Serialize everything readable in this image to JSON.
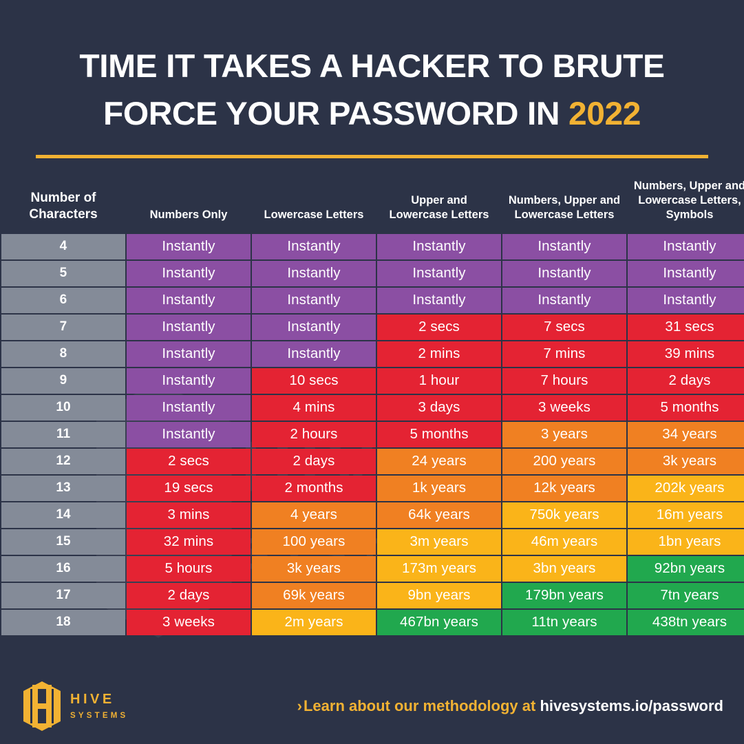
{
  "colors": {
    "background": "#2c3347",
    "accent": "#f2b233",
    "gray": "#848b98",
    "purple": "#8b4fa3",
    "red": "#e42333",
    "orange": "#f08022",
    "yellow": "#fab419",
    "green": "#21a84e",
    "text": "#ffffff"
  },
  "header": {
    "title_line1": "TIME IT TAKES A HACKER TO BRUTE",
    "title_line2_prefix": "FORCE YOUR PASSWORD IN ",
    "title_year": "2022"
  },
  "table": {
    "columns": [
      "Number of Characters",
      "Numbers Only",
      "Lowercase Letters",
      "Upper and Lowercase Letters",
      "Numbers, Upper and Lowercase Letters",
      "Numbers, Upper and Lowercase Letters, Symbols"
    ],
    "rows": [
      {
        "chars": "4",
        "cells": [
          "Instantly",
          "Instantly",
          "Instantly",
          "Instantly",
          "Instantly"
        ],
        "colors": [
          "purple",
          "purple",
          "purple",
          "purple",
          "purple"
        ]
      },
      {
        "chars": "5",
        "cells": [
          "Instantly",
          "Instantly",
          "Instantly",
          "Instantly",
          "Instantly"
        ],
        "colors": [
          "purple",
          "purple",
          "purple",
          "purple",
          "purple"
        ]
      },
      {
        "chars": "6",
        "cells": [
          "Instantly",
          "Instantly",
          "Instantly",
          "Instantly",
          "Instantly"
        ],
        "colors": [
          "purple",
          "purple",
          "purple",
          "purple",
          "purple"
        ]
      },
      {
        "chars": "7",
        "cells": [
          "Instantly",
          "Instantly",
          "2 secs",
          "7 secs",
          "31 secs"
        ],
        "colors": [
          "purple",
          "purple",
          "red",
          "red",
          "red"
        ]
      },
      {
        "chars": "8",
        "cells": [
          "Instantly",
          "Instantly",
          "2 mins",
          "7 mins",
          "39 mins"
        ],
        "colors": [
          "purple",
          "purple",
          "red",
          "red",
          "red"
        ]
      },
      {
        "chars": "9",
        "cells": [
          "Instantly",
          "10 secs",
          "1 hour",
          "7 hours",
          "2 days"
        ],
        "colors": [
          "purple",
          "red",
          "red",
          "red",
          "red"
        ]
      },
      {
        "chars": "10",
        "cells": [
          "Instantly",
          "4 mins",
          "3 days",
          "3 weeks",
          "5 months"
        ],
        "colors": [
          "purple",
          "red",
          "red",
          "red",
          "red"
        ]
      },
      {
        "chars": "11",
        "cells": [
          "Instantly",
          "2 hours",
          "5 months",
          "3 years",
          "34 years"
        ],
        "colors": [
          "purple",
          "red",
          "red",
          "orange",
          "orange"
        ]
      },
      {
        "chars": "12",
        "cells": [
          "2 secs",
          "2 days",
          "24 years",
          "200 years",
          "3k years"
        ],
        "colors": [
          "red",
          "red",
          "orange",
          "orange",
          "orange"
        ]
      },
      {
        "chars": "13",
        "cells": [
          "19 secs",
          "2 months",
          "1k years",
          "12k years",
          "202k years"
        ],
        "colors": [
          "red",
          "red",
          "orange",
          "orange",
          "yellow"
        ]
      },
      {
        "chars": "14",
        "cells": [
          "3 mins",
          "4 years",
          "64k years",
          "750k years",
          "16m years"
        ],
        "colors": [
          "red",
          "orange",
          "orange",
          "yellow",
          "yellow"
        ]
      },
      {
        "chars": "15",
        "cells": [
          "32 mins",
          "100 years",
          "3m years",
          "46m years",
          "1bn years"
        ],
        "colors": [
          "red",
          "orange",
          "yellow",
          "yellow",
          "yellow"
        ]
      },
      {
        "chars": "16",
        "cells": [
          "5 hours",
          "3k years",
          "173m years",
          "3bn years",
          "92bn years"
        ],
        "colors": [
          "red",
          "orange",
          "yellow",
          "yellow",
          "green"
        ]
      },
      {
        "chars": "17",
        "cells": [
          "2 days",
          "69k years",
          "9bn years",
          "179bn years",
          "7tn years"
        ],
        "colors": [
          "red",
          "orange",
          "yellow",
          "green",
          "green"
        ]
      },
      {
        "chars": "18",
        "cells": [
          "3 weeks",
          "2m years",
          "467bn years",
          "11tn years",
          "438tn years"
        ],
        "colors": [
          "red",
          "yellow",
          "green",
          "green",
          "green"
        ]
      }
    ]
  },
  "footer": {
    "logo_hive": "HIVE",
    "logo_systems": "SYSTEMS",
    "cta_chevron": "›",
    "cta_text": "Learn about our methodology at ",
    "cta_url": "hivesystems.io/password"
  }
}
